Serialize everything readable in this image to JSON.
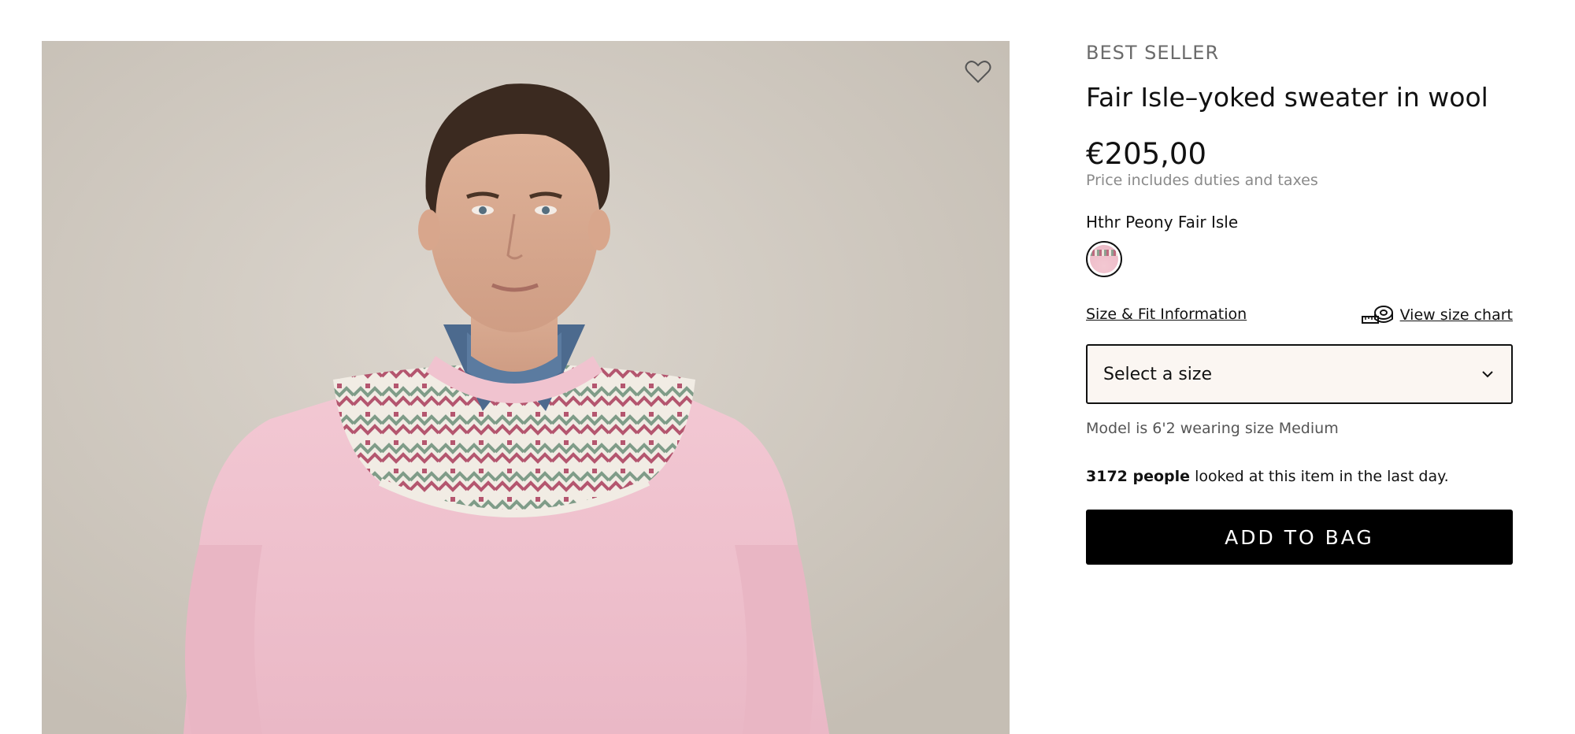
{
  "product": {
    "badge": "BEST SELLER",
    "title": "Fair Isle–yoked sweater in wool",
    "price": "€205,00",
    "price_note": "Price includes duties and taxes",
    "color_name": "Hthr Peony Fair Isle",
    "image_alt": "Model wearing pink Fair Isle–yoked sweater"
  },
  "sizing": {
    "fit_link": "Size & Fit Information",
    "size_chart_link": "View size chart",
    "select_placeholder": "Select a size",
    "model_info": "Model is 6'2 wearing size Medium"
  },
  "social_proof": {
    "count_text": "3172 people",
    "rest_text": " looked at this item in the last day."
  },
  "actions": {
    "add_to_bag": "ADD TO BAG"
  },
  "icons": {
    "wishlist": "heart-outline-icon",
    "size_chart": "measuring-tape-icon",
    "select": "chevron-down-icon"
  },
  "colors": {
    "button_bg": "#000000",
    "select_bg": "#fbf6f2",
    "sweater": "#efc2cf"
  }
}
